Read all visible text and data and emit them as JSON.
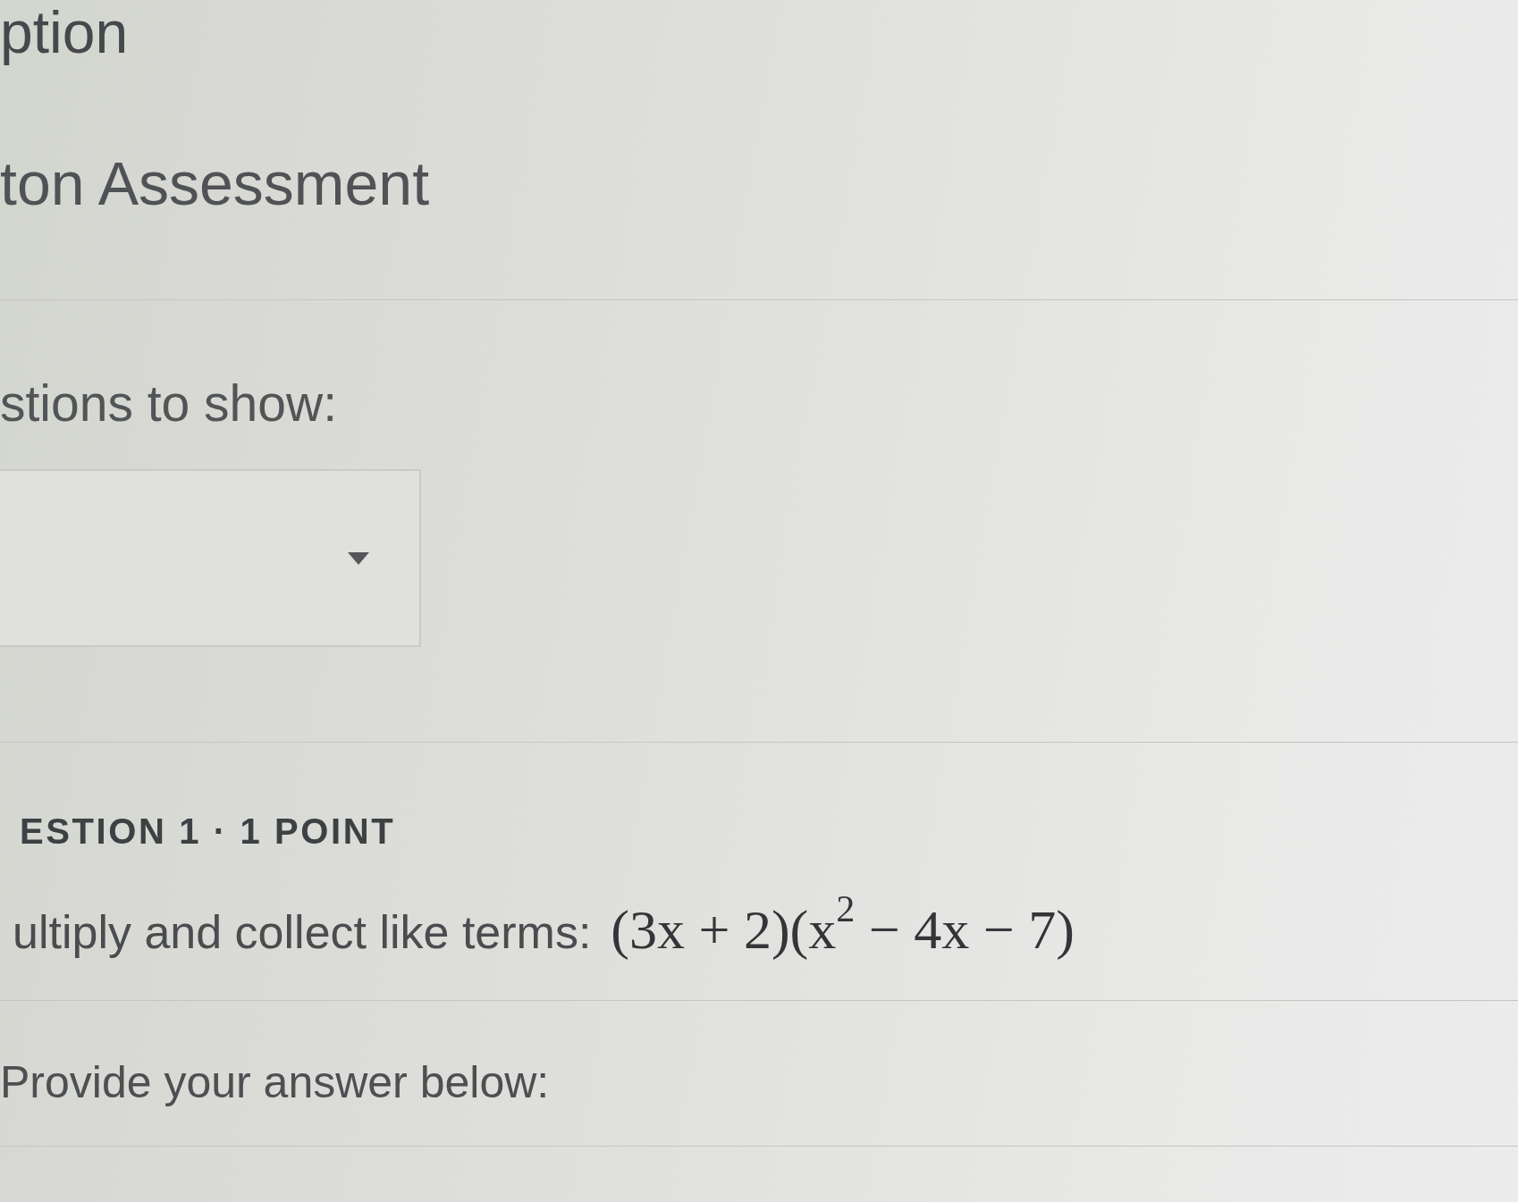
{
  "page": {
    "title_fragment": "ption",
    "heading": "ton Assessment"
  },
  "filter": {
    "label": "stions to show:",
    "dropdown": {
      "expanded": false
    }
  },
  "question": {
    "header": "ESTION 1 · 1 POINT",
    "prompt": "ultiply and collect like terms:",
    "expression": "(3x + 2)(x$^{2}$ − 4x − 7)",
    "answer_label": "Provide your answer below:"
  }
}
